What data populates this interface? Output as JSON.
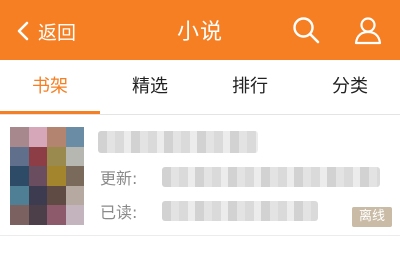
{
  "header": {
    "back_label": "返回",
    "title": "小说",
    "background": "#f57f22",
    "icons": [
      "back-chevron-icon",
      "search-icon",
      "user-icon"
    ]
  },
  "tabs": [
    {
      "label": "书架",
      "active": true
    },
    {
      "label": "精选",
      "active": false
    },
    {
      "label": "排行",
      "active": false
    },
    {
      "label": "分类",
      "active": false
    }
  ],
  "book": {
    "update_label": "更新:",
    "read_label": "已读:",
    "offline_badge": "离线"
  },
  "accent_color": "#f57f22"
}
